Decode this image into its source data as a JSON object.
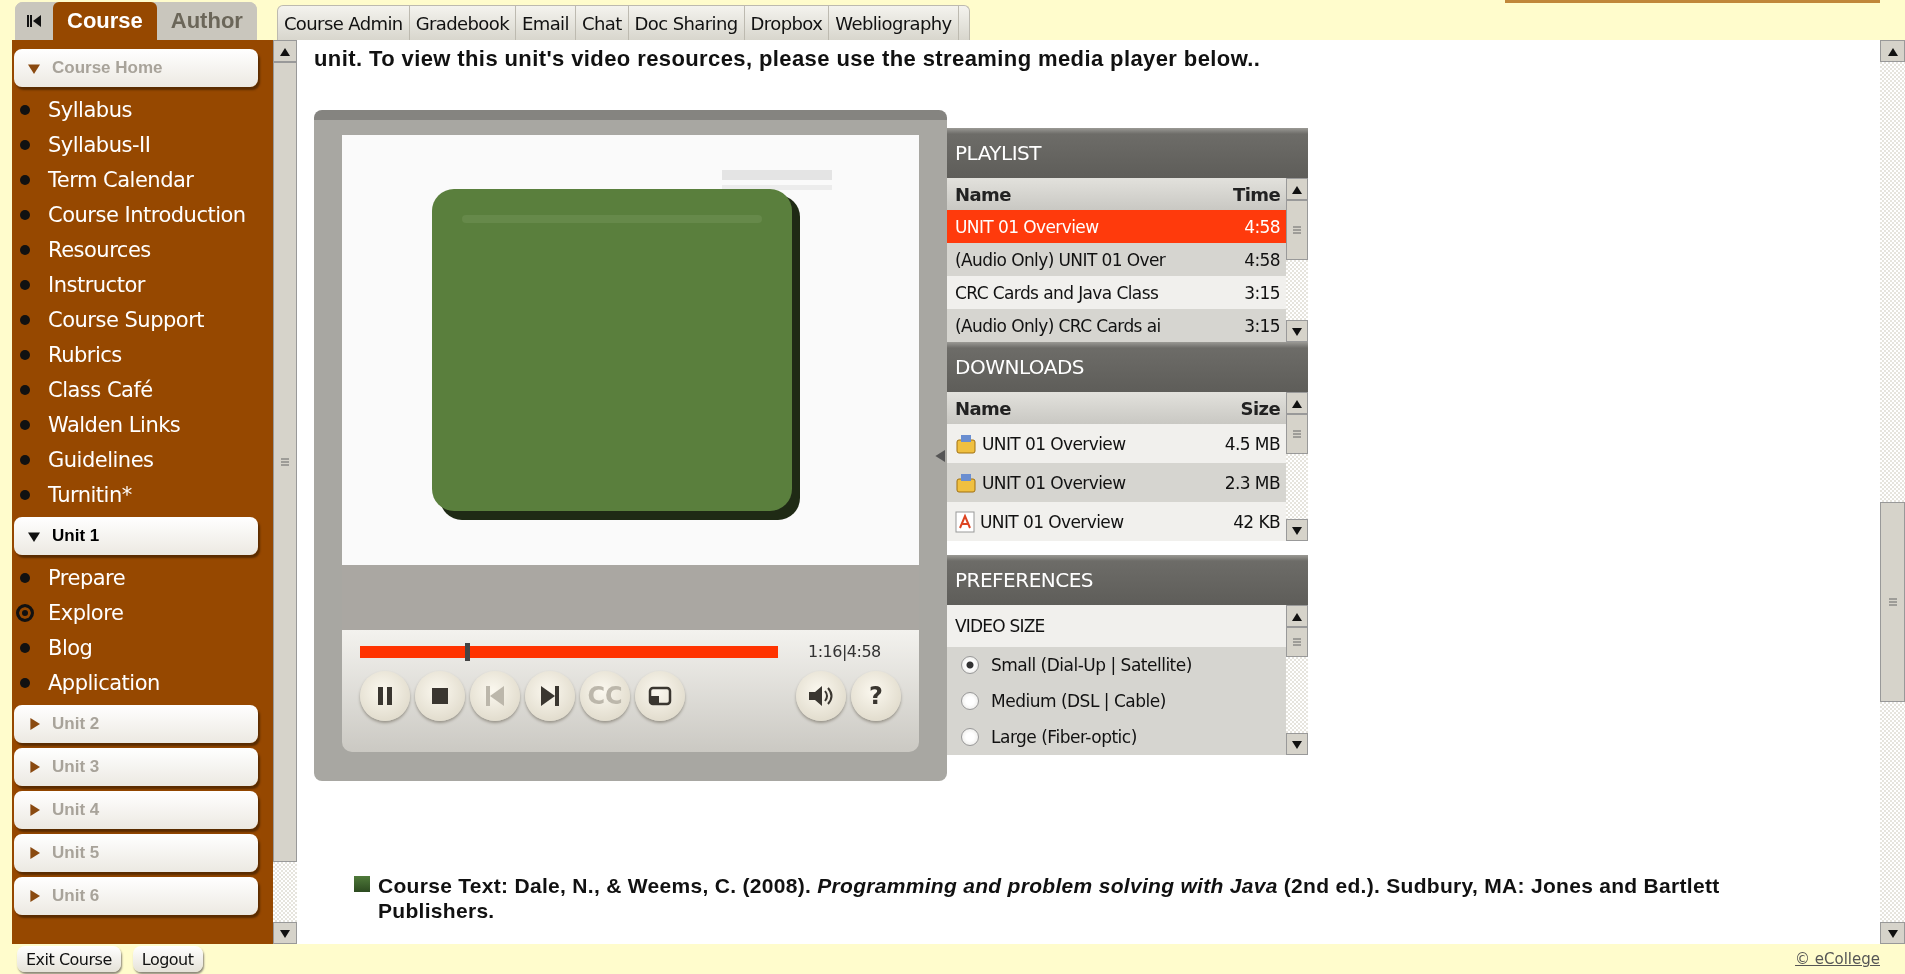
{
  "mode_tabs": [
    {
      "label": "Course",
      "selected": true
    },
    {
      "label": "Author",
      "selected": false
    }
  ],
  "nav_tabs": [
    "Course Admin",
    "Gradebook",
    "Email",
    "Chat",
    "Doc Sharing",
    "Dropbox",
    "Webliography"
  ],
  "sidebar": {
    "sections": [
      {
        "label": "Course Home",
        "expanded": true,
        "current": false,
        "children": [
          {
            "label": "Syllabus",
            "selected": false
          },
          {
            "label": "Syllabus-II",
            "selected": false
          },
          {
            "label": "Term Calendar",
            "selected": false
          },
          {
            "label": "Course Introduction",
            "selected": false
          },
          {
            "label": "Resources",
            "selected": false
          },
          {
            "label": "Instructor",
            "selected": false
          },
          {
            "label": "Course Support",
            "selected": false
          },
          {
            "label": "Rubrics",
            "selected": false
          },
          {
            "label": "Class Café",
            "selected": false
          },
          {
            "label": "Walden Links",
            "selected": false
          },
          {
            "label": "Guidelines",
            "selected": false
          },
          {
            "label": "Turnitin*",
            "selected": false
          }
        ]
      },
      {
        "label": "Unit 1",
        "expanded": true,
        "current": true,
        "children": [
          {
            "label": "Prepare",
            "selected": false
          },
          {
            "label": "Explore",
            "selected": true
          },
          {
            "label": "Blog",
            "selected": false
          },
          {
            "label": "Application",
            "selected": false
          }
        ]
      },
      {
        "label": "Unit 2",
        "expanded": false,
        "current": false
      },
      {
        "label": "Unit 3",
        "expanded": false,
        "current": false
      },
      {
        "label": "Unit 4",
        "expanded": false,
        "current": false
      },
      {
        "label": "Unit 5",
        "expanded": false,
        "current": false
      },
      {
        "label": "Unit 6",
        "expanded": false,
        "current": false
      }
    ]
  },
  "content": {
    "intro": "unit. To view this unit's video resources, please use the streaming media player below..",
    "player": {
      "time": "1:16|4:58",
      "progress": {
        "level": 0.255
      },
      "controls": [
        {
          "kind": "pause",
          "disabled": false
        },
        {
          "kind": "stop",
          "disabled": false
        },
        {
          "kind": "previous",
          "disabled": true
        },
        {
          "kind": "next",
          "disabled": false
        },
        {
          "kind": "captions",
          "label": "CC",
          "disabled": true
        },
        {
          "kind": "window",
          "disabled": false
        }
      ],
      "extra_controls": [
        {
          "kind": "volume",
          "disabled": false
        },
        {
          "kind": "help",
          "label": "?",
          "disabled": false
        }
      ],
      "playlist": {
        "title": "PLAYLIST",
        "columns": [
          "Name",
          "Time"
        ],
        "rows": [
          {
            "name": "UNIT 01 Overview",
            "time": "4:58",
            "selected": true
          },
          {
            "name": "(Audio Only) UNIT 01 Over",
            "time": "4:58",
            "selected": false
          },
          {
            "name": "CRC Cards and Java Class",
            "time": "3:15",
            "selected": false
          },
          {
            "name": "(Audio Only) CRC Cards ai",
            "time": "3:15",
            "selected": false
          }
        ]
      },
      "downloads": {
        "title": "DOWNLOADS",
        "columns": [
          "Name",
          "Size"
        ],
        "rows": [
          {
            "kind": "archive",
            "name": "UNIT 01 Overview",
            "size": "4.5 MB"
          },
          {
            "kind": "archive",
            "name": "UNIT 01 Overview",
            "size": "2.3 MB"
          },
          {
            "kind": "pdf",
            "name": "UNIT 01 Overview",
            "size": "42 KB"
          }
        ]
      },
      "preferences": {
        "title": "PREFERENCES",
        "group": "VIDEO SIZE",
        "options": [
          {
            "label": "Small (Dial-Up | Satellite)",
            "selected": true
          },
          {
            "label": "Medium (DSL | Cable)",
            "selected": false
          },
          {
            "label": "Large (Fiber-optic)",
            "selected": false
          }
        ]
      }
    },
    "citation": "Course Text: Dale, N., & Weems, C. (2008). *Programming and problem solving with Java* (2nd ed.). Sudbury, MA: Jones and Bartlett Publishers."
  },
  "footer": {
    "buttons": [
      "Exit Course",
      "Logout"
    ],
    "link": "© eCollege"
  }
}
